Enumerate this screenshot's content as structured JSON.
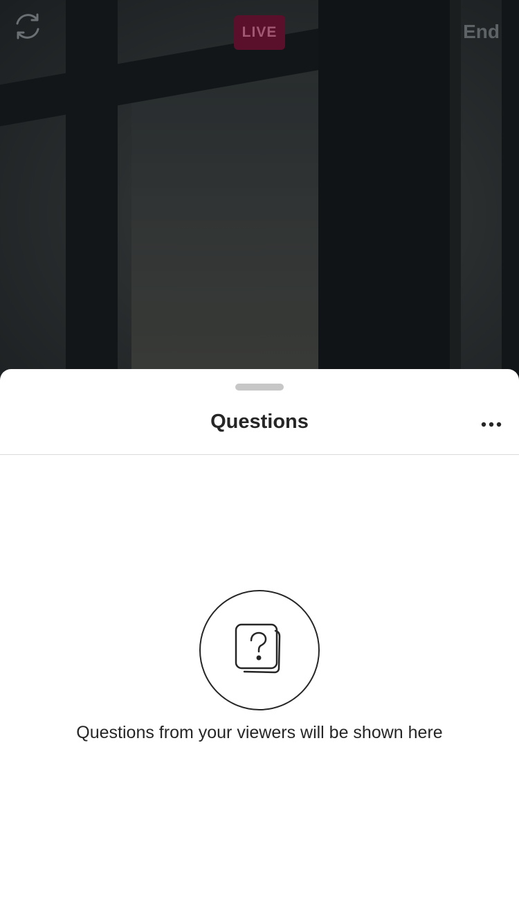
{
  "topbar": {
    "live_label": "LIVE",
    "end_label": "End",
    "switch_camera_icon": "switch-camera-icon"
  },
  "questions_sheet": {
    "title": "Questions",
    "more_icon": "more-horizontal-icon",
    "empty_state_icon": "question-cards-icon",
    "empty_message": "Questions from your viewers will be shown here"
  },
  "colors": {
    "live_badge": "#5a0f2a",
    "sheet_background": "#ffffff",
    "text_primary": "#262626",
    "divider": "#dbdbdb"
  }
}
